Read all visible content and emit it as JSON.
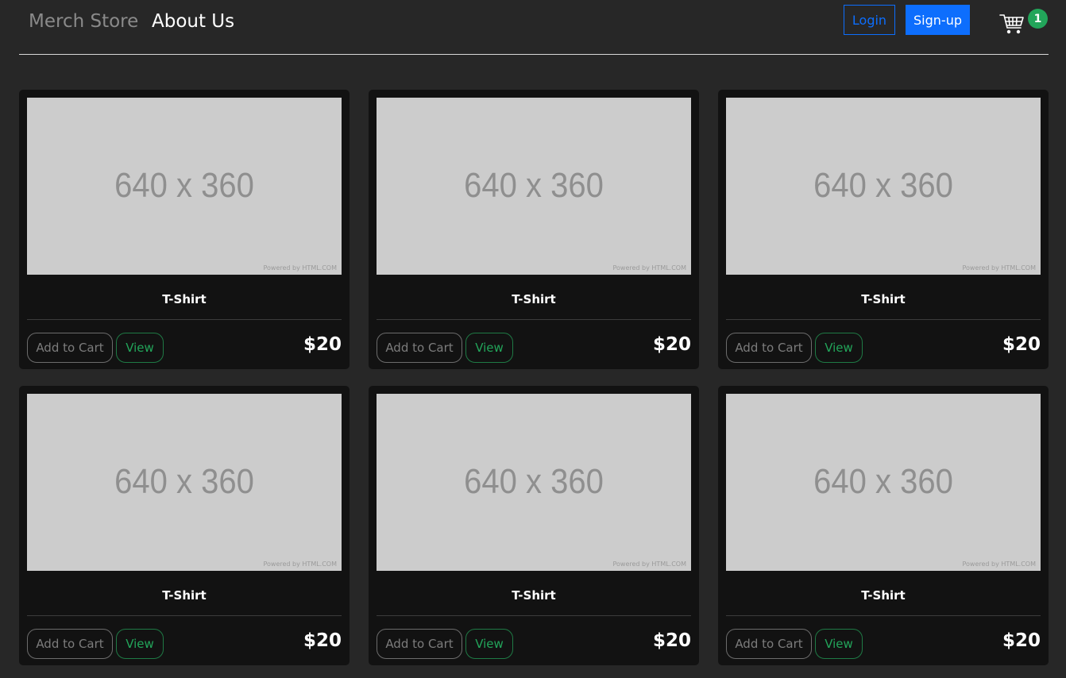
{
  "header": {
    "brand": "Merch Store",
    "nav_about": "About Us",
    "login_label": "Login",
    "signup_label": "Sign-up",
    "cart_count": "1"
  },
  "products": [
    {
      "image_text": "640 x 360",
      "image_credit": "Powered by HTML.COM",
      "name": "T-Shirt",
      "add_label": "Add to Cart",
      "view_label": "View",
      "price": "$20"
    },
    {
      "image_text": "640 x 360",
      "image_credit": "Powered by HTML.COM",
      "name": "T-Shirt",
      "add_label": "Add to Cart",
      "view_label": "View",
      "price": "$20"
    },
    {
      "image_text": "640 x 360",
      "image_credit": "Powered by HTML.COM",
      "name": "T-Shirt",
      "add_label": "Add to Cart",
      "view_label": "View",
      "price": "$20"
    },
    {
      "image_text": "640 x 360",
      "image_credit": "Powered by HTML.COM",
      "name": "T-Shirt",
      "add_label": "Add to Cart",
      "view_label": "View",
      "price": "$20"
    },
    {
      "image_text": "640 x 360",
      "image_credit": "Powered by HTML.COM",
      "name": "T-Shirt",
      "add_label": "Add to Cart",
      "view_label": "View",
      "price": "$20"
    },
    {
      "image_text": "640 x 360",
      "image_credit": "Powered by HTML.COM",
      "name": "T-Shirt",
      "add_label": "Add to Cart",
      "view_label": "View",
      "price": "$20"
    }
  ],
  "colors": {
    "background": "#272727",
    "card": "#121212",
    "primary": "#0d6efd",
    "success": "#22a55a"
  },
  "icons": {
    "cart": "shopping-cart-icon"
  }
}
